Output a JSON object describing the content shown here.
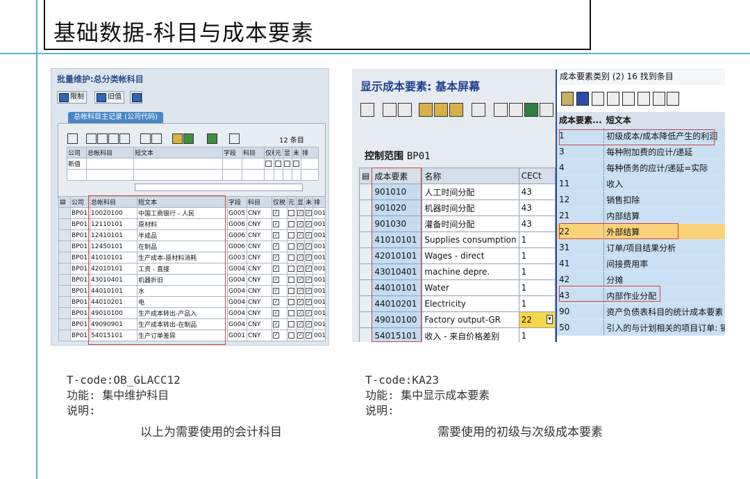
{
  "slide": {
    "title": "基础数据-科目与成本要素"
  },
  "left_screen": {
    "title": "批量维护:总分类帐科目",
    "buttons": [
      "限制",
      "旧值"
    ],
    "tab": "总帐科目主记录 (公司代码)",
    "count_text": "12 条目",
    "edit_headers": [
      "公司",
      "总帐科目",
      "短文本",
      "字段",
      "科目",
      "仅税",
      "元",
      "显",
      "未",
      "排"
    ],
    "edit_row_label": "新值",
    "headers": [
      "公司",
      "总帐科目",
      "短文本",
      "字段",
      "科目",
      "仅税",
      "元",
      "显",
      "未",
      "排"
    ],
    "rows": [
      {
        "company": "BP01",
        "account": "10020100",
        "text": "中国工商银行 - 人民",
        "field": "G005",
        "cur": "CNY",
        "sort": "001"
      },
      {
        "company": "BP01",
        "account": "12110101",
        "text": "原材料",
        "field": "G006",
        "cur": "CNY",
        "sort": "001"
      },
      {
        "company": "BP01",
        "account": "12410101",
        "text": "半成品",
        "field": "G006",
        "cur": "CNY",
        "sort": "001"
      },
      {
        "company": "BP01",
        "account": "12450101",
        "text": "在制品",
        "field": "G006",
        "cur": "CNY",
        "sort": "001"
      },
      {
        "company": "BP01",
        "account": "41010101",
        "text": "生产成本-原材料消耗",
        "field": "G003",
        "cur": "CNY",
        "sort": "001"
      },
      {
        "company": "BP01",
        "account": "42010101",
        "text": "工资 - 直接",
        "field": "G004",
        "cur": "CNY",
        "sort": "001"
      },
      {
        "company": "BP01",
        "account": "43010401",
        "text": "机器折旧",
        "field": "G004",
        "cur": "CNY",
        "sort": "001"
      },
      {
        "company": "BP01",
        "account": "44010101",
        "text": "水",
        "field": "G004",
        "cur": "CNY",
        "sort": "001"
      },
      {
        "company": "BP01",
        "account": "44010201",
        "text": "电",
        "field": "G004",
        "cur": "CNY",
        "sort": "001"
      },
      {
        "company": "BP01",
        "account": "49010100",
        "text": "生产成本转出-产品入",
        "field": "G004",
        "cur": "CNY",
        "sort": "001"
      },
      {
        "company": "BP01",
        "account": "49090901",
        "text": "生产成本转出-在制品",
        "field": "G004",
        "cur": "CNY",
        "sort": "001"
      },
      {
        "company": "BP01",
        "account": "54015101",
        "text": "生产订单差异",
        "field": "G001",
        "cur": "CNY",
        "sort": "001"
      }
    ]
  },
  "right_screen": {
    "title": "显示成本要素: 基本屏幕",
    "control_scope_label": "控制范围",
    "control_scope_value": "BP01",
    "headers": [
      "成本要素",
      "名称",
      "CECt"
    ],
    "rows": [
      {
        "code": "901010",
        "name": "人工时间分配",
        "cat": "43"
      },
      {
        "code": "901020",
        "name": "机器时间分配",
        "cat": "43"
      },
      {
        "code": "901030",
        "name": "灌备时间分配",
        "cat": "43"
      },
      {
        "code": "41010101",
        "name": "Supplies consumption",
        "cat": "1"
      },
      {
        "code": "42010101",
        "name": "Wages - direct",
        "cat": "1"
      },
      {
        "code": "43010401",
        "name": "machine depre.",
        "cat": "1"
      },
      {
        "code": "44010101",
        "name": "Water",
        "cat": "1"
      },
      {
        "code": "44010201",
        "name": "Electricity",
        "cat": "1"
      },
      {
        "code": "49010100",
        "name": "Factory output-GR",
        "cat": "22"
      },
      {
        "code": "54015101",
        "name": "收入 - 来自价格差别",
        "cat": "1"
      }
    ],
    "popup": {
      "title": "成本要素类别 (2)   16 找到条目",
      "headers": [
        "成本要素...",
        "短文本"
      ],
      "rows": [
        {
          "k": "1",
          "t": "初级成本/成本降低产生的利润"
        },
        {
          "k": "3",
          "t": "每种附加费的应计/递延"
        },
        {
          "k": "4",
          "t": "每种债务的应计/递延=实际"
        },
        {
          "k": "11",
          "t": "收入"
        },
        {
          "k": "12",
          "t": "销售扣除"
        },
        {
          "k": "21",
          "t": "内部结算"
        },
        {
          "k": "22",
          "t": "外部结算"
        },
        {
          "k": "31",
          "t": "订单/项目结果分析"
        },
        {
          "k": "41",
          "t": "间接费用率"
        },
        {
          "k": "42",
          "t": "分摊"
        },
        {
          "k": "43",
          "t": "内部作业分配"
        },
        {
          "k": "90",
          "t": "资产负债表科目的统计成本要素"
        },
        {
          "k": "50",
          "t": "引入的与计划相关的项目订单: 销"
        }
      ]
    }
  },
  "notes": {
    "left": {
      "tcode": "T-code:OB_GLACC12",
      "func": "功能: 集中维护科目",
      "desc": "说明:",
      "remark": "以上为需要使用的会计科目"
    },
    "right": {
      "tcode": "T-code:KA23",
      "func": "功能: 集中显示成本要素",
      "desc": "说明:",
      "remark": "需要使用的初级与次级成本要素"
    }
  }
}
